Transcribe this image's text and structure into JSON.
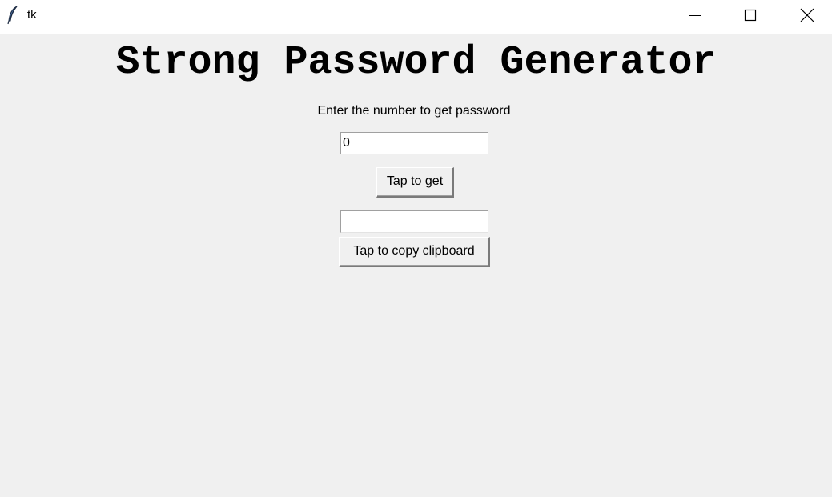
{
  "window": {
    "title": "tk",
    "icons": {
      "app": "feather-icon",
      "minimize": "minimize-icon",
      "maximize": "maximize-icon",
      "close": "close-icon"
    }
  },
  "main": {
    "heading": "Strong Password Generator",
    "prompt_label": "Enter the number to get password",
    "length_entry_value": "0",
    "get_button_label": "Tap to get",
    "password_entry_value": "",
    "copy_button_label": "Tap to copy clipboard"
  },
  "colors": {
    "background": "#f0f0f0",
    "titlebar": "#ffffff",
    "text": "#000000",
    "feather": "#4a6fa5"
  }
}
